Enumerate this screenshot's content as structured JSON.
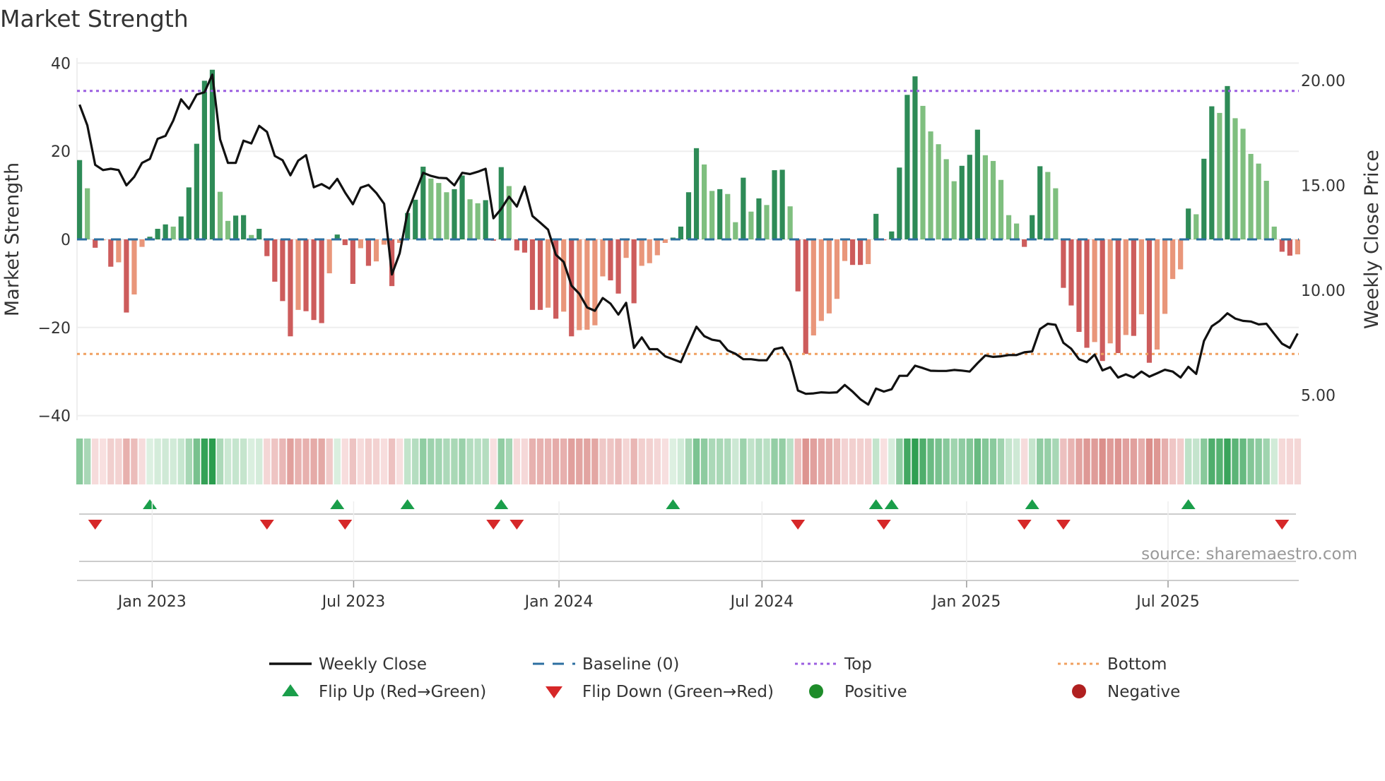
{
  "title": "Market Strength",
  "source": "source: sharemaestro.com",
  "chart_data": {
    "type": "bar+line",
    "title": "Market Strength",
    "ylabel_left": "Market Strength",
    "ylabel_right": "Weekly Close Price",
    "ylim_left": [
      -40,
      40
    ],
    "ylim_right": [
      4.0,
      20.8
    ],
    "left_ticks": [
      {
        "value": 40,
        "label": "40"
      },
      {
        "value": 20,
        "label": "20"
      },
      {
        "value": 0,
        "label": "0"
      },
      {
        "value": -20,
        "label": "−20"
      },
      {
        "value": -40,
        "label": "−40"
      }
    ],
    "right_ticks": [
      {
        "value": 20,
        "label": "20.00"
      },
      {
        "value": 15,
        "label": "15.00"
      },
      {
        "value": 10,
        "label": "10.00"
      },
      {
        "value": 5,
        "label": "5.00"
      }
    ],
    "x_ticks": [
      {
        "week": 9.3,
        "label": "Jan 2023"
      },
      {
        "week": 35.1,
        "label": "Jul 2023"
      },
      {
        "week": 61.4,
        "label": "Jan 2024"
      },
      {
        "week": 87.4,
        "label": "Jul 2024"
      },
      {
        "week": 113.6,
        "label": "Jan 2025"
      },
      {
        "week": 139.4,
        "label": "Jul 2025"
      }
    ],
    "top_level": 33.7,
    "bottom_level": -26,
    "baseline": 0,
    "strength": [
      18,
      11.6,
      -1.9,
      -0.2,
      -6.2,
      -5.2,
      -16.6,
      -12.5,
      -1.7,
      0.6,
      2.4,
      3.4,
      2.9,
      5.2,
      11.8,
      21.7,
      36,
      38.5,
      10.8,
      4.2,
      5.4,
      5.5,
      1,
      2.4,
      -3.8,
      -9.6,
      -14,
      -22,
      -16,
      -16.3,
      -18.3,
      -19,
      -7.7,
      1.1,
      -1.3,
      -10.1,
      -2,
      -6,
      -5,
      -1.2,
      -10.6,
      -0.8,
      6,
      9,
      16.5,
      13.8,
      12.8,
      10.7,
      11.4,
      14.5,
      9.1,
      8.2,
      8.9,
      -0.3,
      16.4,
      12.1,
      -2.5,
      -3,
      -16,
      -16,
      -15.5,
      -18,
      -16.4,
      -22,
      -20.6,
      -20.5,
      -19.5,
      -8.4,
      -9.3,
      -12.3,
      -4.2,
      -14.5,
      -6,
      -5.4,
      -3.6,
      -0.8,
      0.4,
      2.9,
      10.7,
      20.7,
      17,
      11,
      11.4,
      10.3,
      3.9,
      14,
      6.3,
      9.3,
      7.8,
      15.7,
      15.8,
      7.5,
      -11.8,
      -26,
      -21.8,
      -18.5,
      -16.8,
      -13.5,
      -4.9,
      -5.8,
      -5.8,
      -5.6,
      5.8,
      -0.2,
      1.8,
      16.3,
      32.8,
      37,
      30.3,
      24.5,
      21.6,
      18.2,
      13.2,
      16.7,
      19.2,
      24.9,
      19.1,
      17.8,
      13.5,
      5.5,
      3.6,
      -1.7,
      5.5,
      16.6,
      15.3,
      11.6,
      -11,
      -15,
      -21,
      -24.6,
      -23.3,
      -27.6,
      -23.6,
      -25.8,
      -21.7,
      -21.9,
      -17,
      -28,
      -25,
      -16.9,
      -9,
      -6.8,
      7,
      5.7,
      18.3,
      30.2,
      28.7,
      34.8,
      27.5,
      25.1,
      19.4,
      17.2,
      13.3,
      2.9,
      -2.8,
      -3.7,
      -3.4
    ],
    "weekly_close": [
      18.85,
      17.86,
      15.98,
      15.73,
      15.79,
      15.73,
      15.0,
      15.4,
      16.07,
      16.26,
      17.22,
      17.36,
      18.09,
      19.1,
      18.65,
      19.33,
      19.44,
      20.28,
      17.19,
      16.07,
      16.07,
      17.13,
      17.0,
      17.84,
      17.55,
      16.4,
      16.2,
      15.48,
      16.18,
      16.44,
      14.91,
      15.06,
      14.85,
      15.31,
      14.66,
      14.1,
      14.89,
      15.02,
      14.64,
      14.12,
      10.75,
      11.76,
      13.71,
      14.66,
      15.6,
      15.45,
      15.36,
      15.34,
      15.0,
      15.6,
      15.54,
      15.65,
      15.79,
      13.43,
      13.88,
      14.46,
      13.99,
      14.94,
      13.54,
      13.22,
      12.89,
      11.69,
      11.35,
      10.22,
      9.83,
      9.18,
      9.02,
      9.63,
      9.36,
      8.84,
      9.4,
      7.25,
      7.75,
      7.19,
      7.19,
      6.85,
      6.71,
      6.57,
      7.42,
      8.26,
      7.81,
      7.64,
      7.58,
      7.13,
      6.97,
      6.71,
      6.71,
      6.66,
      6.66,
      7.19,
      7.27,
      6.6,
      5.22,
      5.06,
      5.08,
      5.13,
      5.11,
      5.13,
      5.48,
      5.17,
      4.8,
      4.55,
      5.31,
      5.17,
      5.28,
      5.92,
      5.92,
      6.4,
      6.29,
      6.16,
      6.15,
      6.15,
      6.2,
      6.17,
      6.12,
      6.52,
      6.89,
      6.82,
      6.85,
      6.91,
      6.91,
      7.04,
      7.08,
      8.15,
      8.4,
      8.35,
      7.49,
      7.21,
      6.71,
      6.57,
      6.93,
      6.18,
      6.33,
      5.84,
      5.99,
      5.84,
      6.12,
      5.88,
      6.04,
      6.21,
      6.12,
      5.84,
      6.35,
      6.01,
      7.58,
      8.28,
      8.54,
      8.9,
      8.65,
      8.54,
      8.51,
      8.37,
      8.4,
      7.92,
      7.45,
      7.25,
      7.94
    ],
    "flip_up_weeks": [
      9,
      33,
      42,
      54,
      76,
      102,
      104,
      122,
      142
    ],
    "flip_down_weeks": [
      2,
      24,
      34,
      53,
      56,
      92,
      103,
      121,
      126,
      154
    ],
    "legend": [
      {
        "key": "close",
        "label": "Weekly Close"
      },
      {
        "key": "baseline",
        "label": "Baseline (0)"
      },
      {
        "key": "top",
        "label": "Top"
      },
      {
        "key": "bottom",
        "label": "Bottom"
      },
      {
        "key": "flip_up",
        "label": "Flip Up (Red→Green)"
      },
      {
        "key": "flip_down",
        "label": "Flip Down (Green→Red)"
      },
      {
        "key": "positive",
        "label": "Positive"
      },
      {
        "key": "negative",
        "label": "Negative"
      }
    ],
    "colors": {
      "green_strong": "#2e8b57",
      "green_weak": "#7fbf7f",
      "red_strong": "#cd5c5c",
      "red_weak": "#e9967a",
      "close": "#111111",
      "baseline": "#2c6fa0",
      "top": "#9b5fe0",
      "bottom": "#f0a060",
      "flip_up": "#1a9e4a",
      "flip_down": "#d62728",
      "positive": "#1e8c2a",
      "negative": "#b02020"
    }
  }
}
